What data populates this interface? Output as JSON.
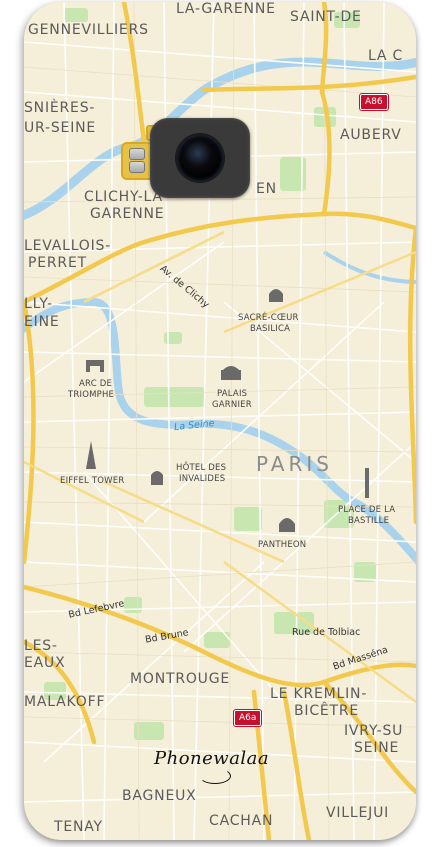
{
  "labels": {
    "la_garenne": "LA-GARENNE",
    "saint_denis": "SAINT-DE",
    "gennevilliers": "GENNEVILLIERS",
    "la_c": "LA C",
    "asnieres_1": "SNIÈRES-",
    "asnieres_2": "UR-SEINE",
    "auberv": "AUBERV",
    "clichy_1": "CLICHY-LA-",
    "clichy_2": "GARENNE",
    "en": "EN",
    "levallois_1": "LEVALLOIS-",
    "levallois_2": "PERRET",
    "lly": "LLY-",
    "seine_left": "EINE",
    "av_clichy": "Av. de Clichy",
    "sacre_1": "SACRÉ-CŒUR",
    "sacre_2": "BASILICA",
    "arc_1": "ARC DE",
    "arc_2": "TRIOMPHE",
    "palais_1": "PALAIS",
    "palais_2": "GARNIER",
    "la_seine": "La Seine",
    "paris": "PARIS",
    "eiffel": "EIFFEL TOWER",
    "hotel_1": "HÔTEL DES",
    "hotel_2": "INVALIDES",
    "bastille_1": "PLACE DE LA",
    "bastille_2": "BASTILLE",
    "pantheon": "PANTHEON",
    "bd_lefebvre": "Bd Lefebvre",
    "bd_brune": "Bd Brune",
    "rue_tolbiac": "Rue de Tolbiac",
    "bd_massena": "Bd Masséna",
    "les": "LES-",
    "eaux": "EAUX",
    "malakoff": "MALAKOFF",
    "montrouge": "MONTROUGE",
    "kremlin_1": "LE KREMLIN-",
    "kremlin_2": "BICÊTRE",
    "ivry_1": "IVRY-SU",
    "ivry_2": "SEINE",
    "bagneux": "BAGNEUX",
    "cachan": "CACHAN",
    "villejuif": "VILLEJUI",
    "fenay": "TENAY"
  },
  "shields": {
    "a86": "A86",
    "a6a": "A6a"
  },
  "brand": "Phonewalaa",
  "colors": {
    "land": "#f5eed8",
    "major_road": "#f2c94c",
    "water": "#a9d3ec",
    "park": "#c8e6b0",
    "shield": "#c8102e"
  }
}
